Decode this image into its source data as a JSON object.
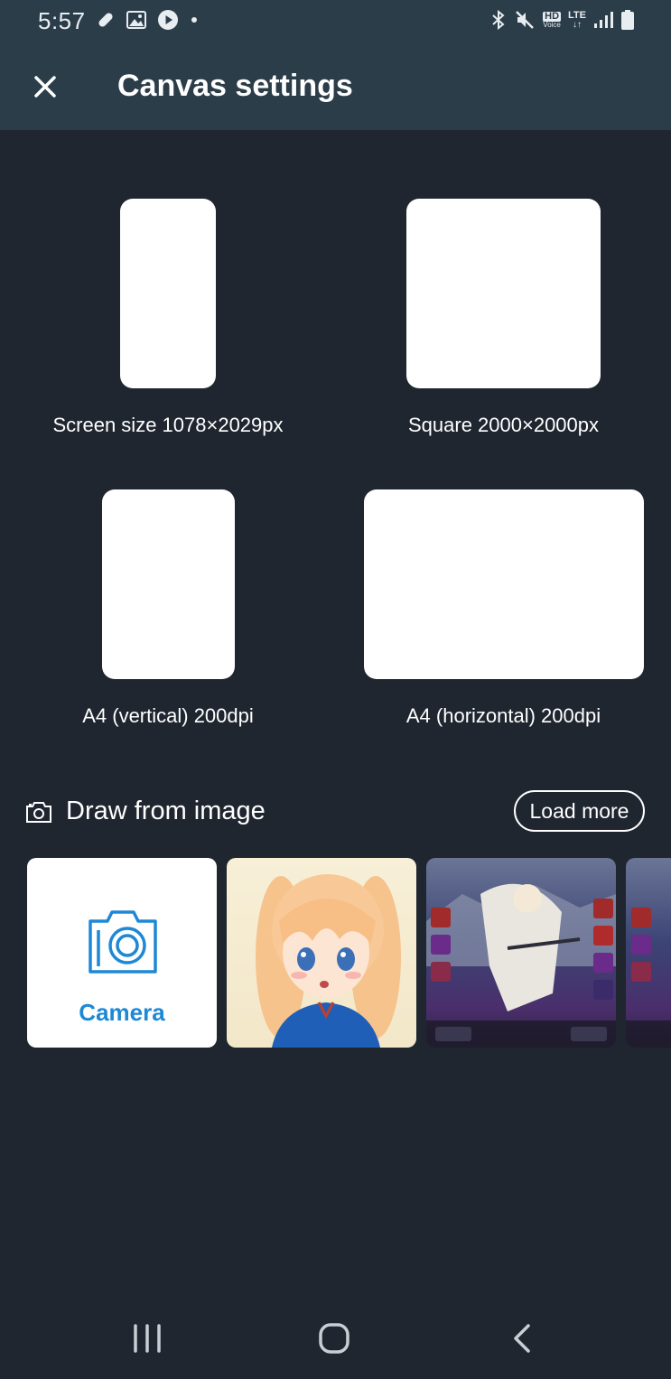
{
  "status_bar": {
    "time": "5:57",
    "left_icons": [
      "bandage-icon",
      "image-icon",
      "play-icon",
      "dot-icon"
    ],
    "right_icons": [
      "bluetooth-icon",
      "mute-icon",
      "hd-voice-icon",
      "lte-icon",
      "signal-icon",
      "battery-icon"
    ],
    "hd_label": "HD",
    "voice_label": "Voice",
    "lte_label": "LTE"
  },
  "app_bar": {
    "title": "Canvas settings",
    "close_icon": "close-icon"
  },
  "presets": [
    {
      "label": "Screen size 1078×2029px"
    },
    {
      "label": "Square 2000×2000px"
    },
    {
      "label": "A4 (vertical) 200dpi"
    },
    {
      "label": "A4 (horizontal) 200dpi"
    }
  ],
  "draw_from_image": {
    "title": "Draw from image",
    "icon": "camera-outline-icon",
    "load_more_label": "Load more",
    "camera_label": "Camera",
    "camera_color": "#1e88d6"
  },
  "colors": {
    "background": "#1f2630",
    "appbar": "#2c3d4a",
    "preset_fill": "#ffffff"
  },
  "nav_bar": {
    "buttons": [
      "recent-apps-icon",
      "home-icon",
      "back-icon"
    ]
  }
}
